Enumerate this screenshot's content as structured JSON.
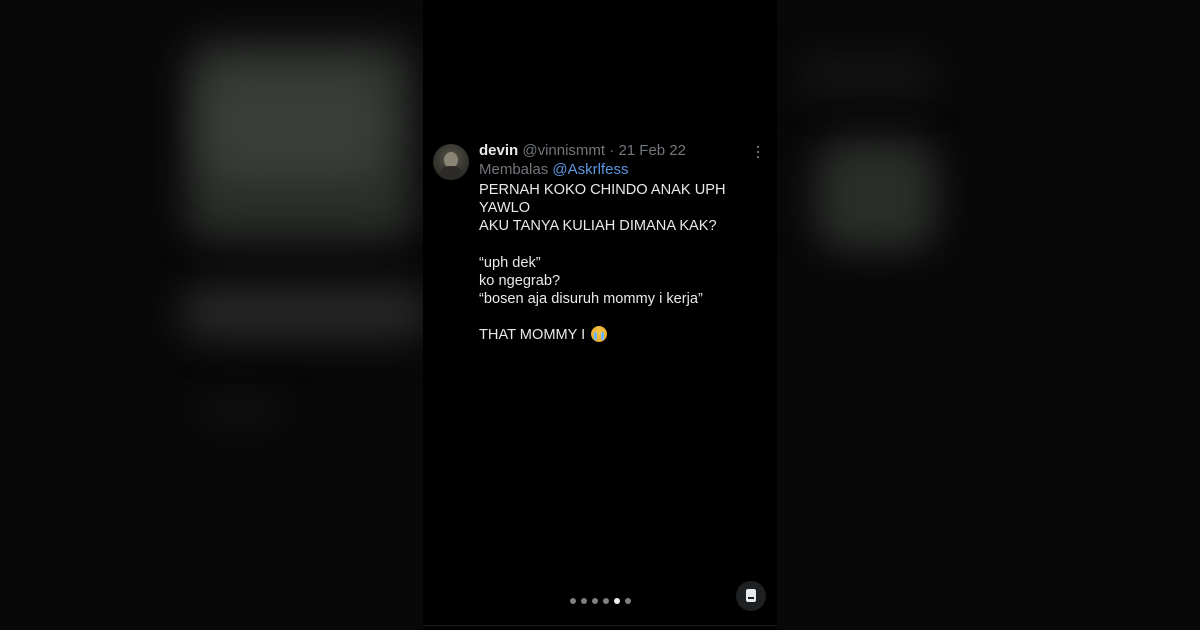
{
  "tweet": {
    "display_name": "devin",
    "handle": "@vinnismmt",
    "separator": " · ",
    "date": "21 Feb 22",
    "reply_prefix": "Membalas",
    "reply_mention": "@Askrlfess",
    "lines": [
      "PERNAH KOKO CHINDO ANAK UPH YAWLO",
      "AKU TANYA KULIAH DIMANA KAK?",
      "“uph dek”",
      "ko ngegrab?",
      "“bosen aja disuruh mommy i kerja”",
      "THAT MOMMY I"
    ],
    "emoji": "loudly-crying-face-emoji"
  },
  "icons": {
    "avatar": "profile-photo",
    "more": "more-vertical-icon",
    "fab": "document-icon"
  },
  "pager": {
    "count": 6,
    "active_index": 4
  },
  "colors": {
    "background": "#000000",
    "text_primary": "#e7e9ea",
    "text_secondary": "#71767b",
    "mention": "#5b97e0",
    "dot_active": "#f2f2f2",
    "dot_inactive": "#808080"
  }
}
